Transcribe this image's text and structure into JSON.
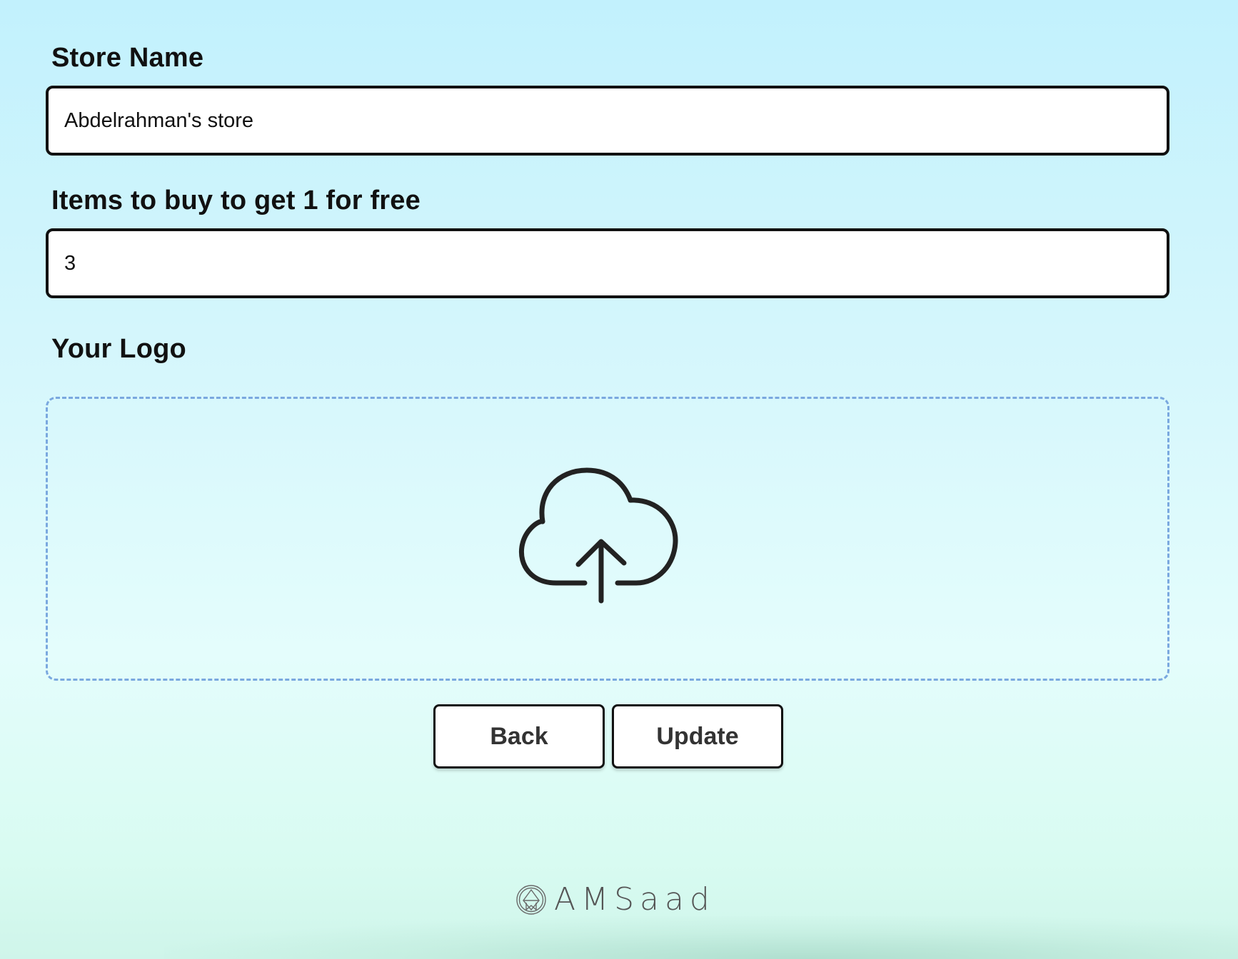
{
  "form": {
    "store_name": {
      "label": "Store Name",
      "value": "Abdelrahman's store"
    },
    "items_to_buy": {
      "label": "Items to buy to get 1 for free",
      "value": "3"
    },
    "logo": {
      "label": "Your Logo",
      "icon": "cloud-upload-icon"
    }
  },
  "actions": {
    "back_label": "Back",
    "update_label": "Update"
  },
  "footer": {
    "brand_name": "AMSaad",
    "brand_icon": "amsaad-logo"
  },
  "colors": {
    "background_top": "#c2f1fd",
    "background_bottom": "#d8fbf1",
    "dropzone_border": "#7aa8df",
    "field_border": "#111111"
  }
}
